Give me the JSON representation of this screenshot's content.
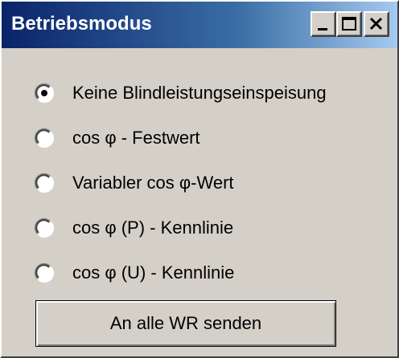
{
  "window": {
    "title": "Betriebsmodus",
    "controls": {
      "minimize_icon": "minimize-icon",
      "maximize_icon": "maximize-icon",
      "close_icon": "close-icon"
    }
  },
  "options": [
    {
      "label": "Keine Blindleistungseinspeisung",
      "selected": true
    },
    {
      "label": "cos φ - Festwert",
      "selected": false
    },
    {
      "label": "Variabler cos φ-Wert",
      "selected": false
    },
    {
      "label": "cos φ (P) - Kennlinie",
      "selected": false
    },
    {
      "label": "cos φ (U) - Kennlinie",
      "selected": false
    }
  ],
  "send_button": {
    "label": "An alle WR senden"
  },
  "colors": {
    "face": "#d4d0c8",
    "title_start": "#0a246a",
    "title_end": "#a6caf0"
  }
}
